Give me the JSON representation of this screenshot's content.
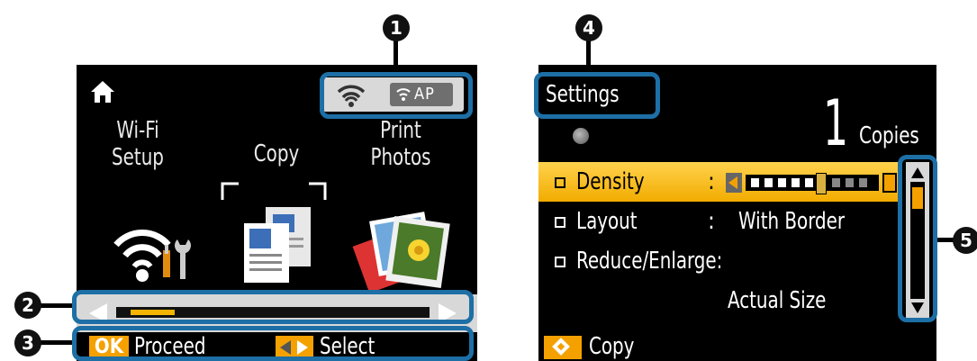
{
  "left_screen": {
    "status": {
      "ap_label": "AP"
    },
    "menu": [
      {
        "label": "Wi-Fi\nSetup"
      },
      {
        "label": "Copy"
      },
      {
        "label": "Print\nPhotos"
      }
    ],
    "scrollbar": {
      "position_fraction": 0.03,
      "thumb_fraction": 0.14
    },
    "footer": {
      "ok_label": "OK",
      "proceed_label": "Proceed",
      "select_label": "Select"
    }
  },
  "right_screen": {
    "title": "Settings",
    "copies": {
      "count": "1",
      "label": "Copies"
    },
    "rows": [
      {
        "label": "Density",
        "colon": ":",
        "value": ""
      },
      {
        "label": "Layout",
        "colon": ":",
        "value": "With Border"
      },
      {
        "label": "Reduce/Enlarge:",
        "colon": "",
        "value": ""
      },
      {
        "label": "",
        "colon": "",
        "value": "Actual Size"
      }
    ],
    "density_level": {
      "current": 5,
      "total": 9
    },
    "vertical_scroll_fraction": 0.0,
    "footer": {
      "start_label": "Copy"
    }
  },
  "callouts": [
    "1",
    "2",
    "3",
    "4",
    "5"
  ],
  "colors": {
    "accent": "#f4a100",
    "callout": "#1d6fa5",
    "highlight": "#ffd24d"
  }
}
